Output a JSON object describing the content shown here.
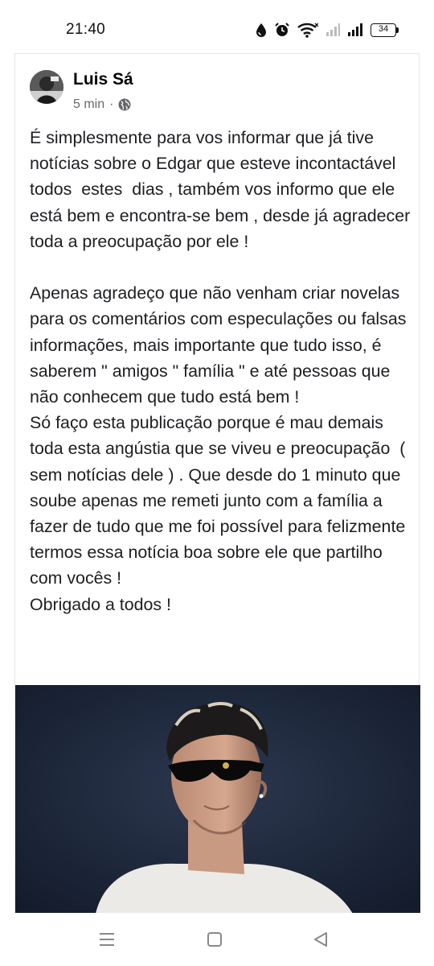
{
  "status_bar": {
    "time": "21:40",
    "battery_level": "34",
    "icons": [
      "water-drop-icon",
      "alarm-icon",
      "wifi-icon",
      "signal-icon",
      "battery-icon"
    ]
  },
  "post": {
    "author": "Luis Sá",
    "timestamp": "5 min",
    "separator": "·",
    "privacy_icon": "globe-icon",
    "text": "É simplesmente para vos informar que já tive notícias sobre o Edgar que esteve incontactável todos  estes  dias , também vos informo que ele está bem e encontra-se bem , desde já agradecer toda a preocupação por ele !\n\nApenas agradeço que não venham criar novelas para os comentários com especulações ou falsas informações, mais importante que tudo isso, é saberem \" amigos \" família \" e até pessoas que não conhecem que tudo está bem !\nSó faço esta publicação porque é mau demais toda esta angústia que se viveu e preocupação  ( sem notícias dele ) . Que desde do 1 minuto que soube apenas me remeti junto com a família a fazer de tudo que me foi possível para felizmente termos essa notícia boa sobre ele que partilho com vocês !\nObrigado a todos !",
    "photo_description_icon": "person-photo"
  },
  "nav_bar": {
    "icons": [
      "menu-icon",
      "home-icon",
      "back-icon"
    ]
  },
  "colors": {
    "photo_background": "#1f2a3d",
    "meta_text": "#65676b",
    "body_text": "#1c1e21"
  }
}
